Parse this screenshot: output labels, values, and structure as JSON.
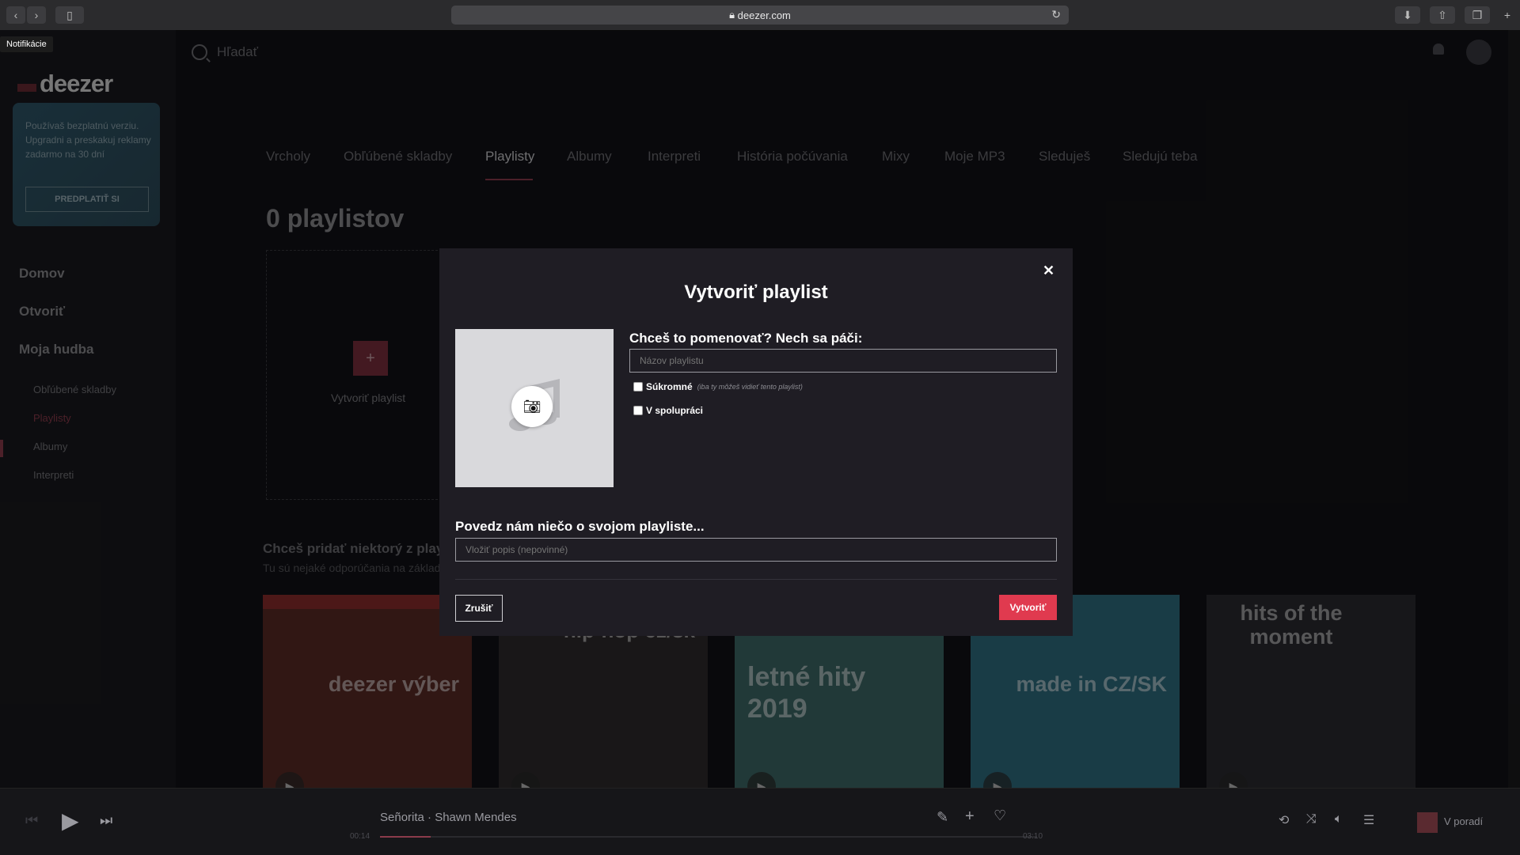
{
  "browser": {
    "url": "deezer.com",
    "tooltip": "Notifikácie"
  },
  "sidebar": {
    "logo": "deezer",
    "promo_text": "Používaš bezplatnú verziu. Upgradni a preskakuj reklamy zadarmo na 30 dní",
    "promo_button": "PREDPLATIŤ SI",
    "main_nav": [
      "Domov",
      "Otvoriť",
      "Moja hudba"
    ],
    "sub_nav": [
      "Obľúbené skladby",
      "Playlisty",
      "Albumy",
      "Interpreti"
    ]
  },
  "header": {
    "search_placeholder": "Hľadať"
  },
  "tabs": [
    "Vrcholy",
    "Obľúbené skladby",
    "Playlisty",
    "Albumy",
    "Interpreti",
    "História počúvania",
    "Mixy",
    "Moje MP3",
    "Sleduješ",
    "Sledujú teba"
  ],
  "active_tab": "Playlisty",
  "page": {
    "title": "0 playlistov",
    "create_label": "Vytvoriť playlist",
    "rec_title": "Chceš pridať niektorý z playlistov",
    "rec_sub": "Tu sú nejaké odporúčania na základe"
  },
  "covers": [
    {
      "text": "deezer výber",
      "color": "#5a2a26"
    },
    {
      "text": "hip-hop cz/sk",
      "color": "#2e2a2c"
    },
    {
      "text": "letné hity 2019",
      "color": "#3c6866"
    },
    {
      "text": "made in CZ/SK",
      "color": "#2f6d80"
    },
    {
      "text": "hits of the moment",
      "color": "#2a2a30"
    }
  ],
  "modal": {
    "title": "Vytvoriť playlist",
    "name_label": "Chceš to pomenovať? Nech sa páči:",
    "name_placeholder": "Názov playlistu",
    "private_label": "Súkromné",
    "private_note": "(iba ty môžeš vidieť tento playlist)",
    "collab_label": "V spolupráci",
    "desc_label": "Povedz nám niečo o svojom playliste...",
    "desc_placeholder": "Vložiť popis (nepovinné)",
    "cancel": "Zrušiť",
    "create": "Vytvoriť"
  },
  "player": {
    "track": "Señorita · Shawn Mendes",
    "elapsed": "00:14",
    "total": "03:10",
    "queue_label": "V poradí",
    "progress": 0.077
  }
}
